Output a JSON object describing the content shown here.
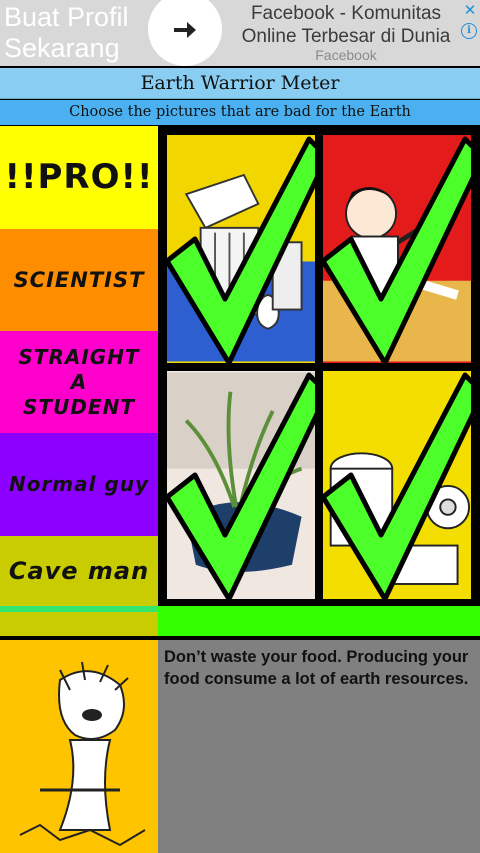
{
  "ad": {
    "left_text": "Buat Profil\nSekarang",
    "title": "Facebook - Komunitas\nOnline Terbesar di Dunia",
    "source": "Facebook",
    "arrow_icon": "arrow-right-icon",
    "close_glyph": "✕",
    "info_glyph": "i"
  },
  "app": {
    "title": "Earth Warrior Meter",
    "instruction": "Choose the pictures that are bad for the Earth"
  },
  "meter": {
    "levels": [
      {
        "label": "!!PRO!!",
        "color": "#ffff00"
      },
      {
        "label": "SCIENTIST",
        "color": "#ff8d00"
      },
      {
        "label": "STRAIGHT A STUDENT",
        "color": "#ff00cc"
      },
      {
        "label": "Normal guy",
        "color": "#8c00ff"
      },
      {
        "label": "Cave man",
        "color": "#c8cc00"
      }
    ],
    "fill_color": "#33e66d"
  },
  "pictures": [
    {
      "name": "trash-can-picture",
      "checked": true
    },
    {
      "name": "boy-picture",
      "checked": true
    },
    {
      "name": "plant-picture",
      "checked": true
    },
    {
      "name": "toilet-paper-picture",
      "checked": true
    }
  ],
  "progress": {
    "value": 1.0,
    "color": "#33ff00"
  },
  "tip": {
    "text": "Don’t waste your food. Producing your food consume a lot of earth resources."
  }
}
